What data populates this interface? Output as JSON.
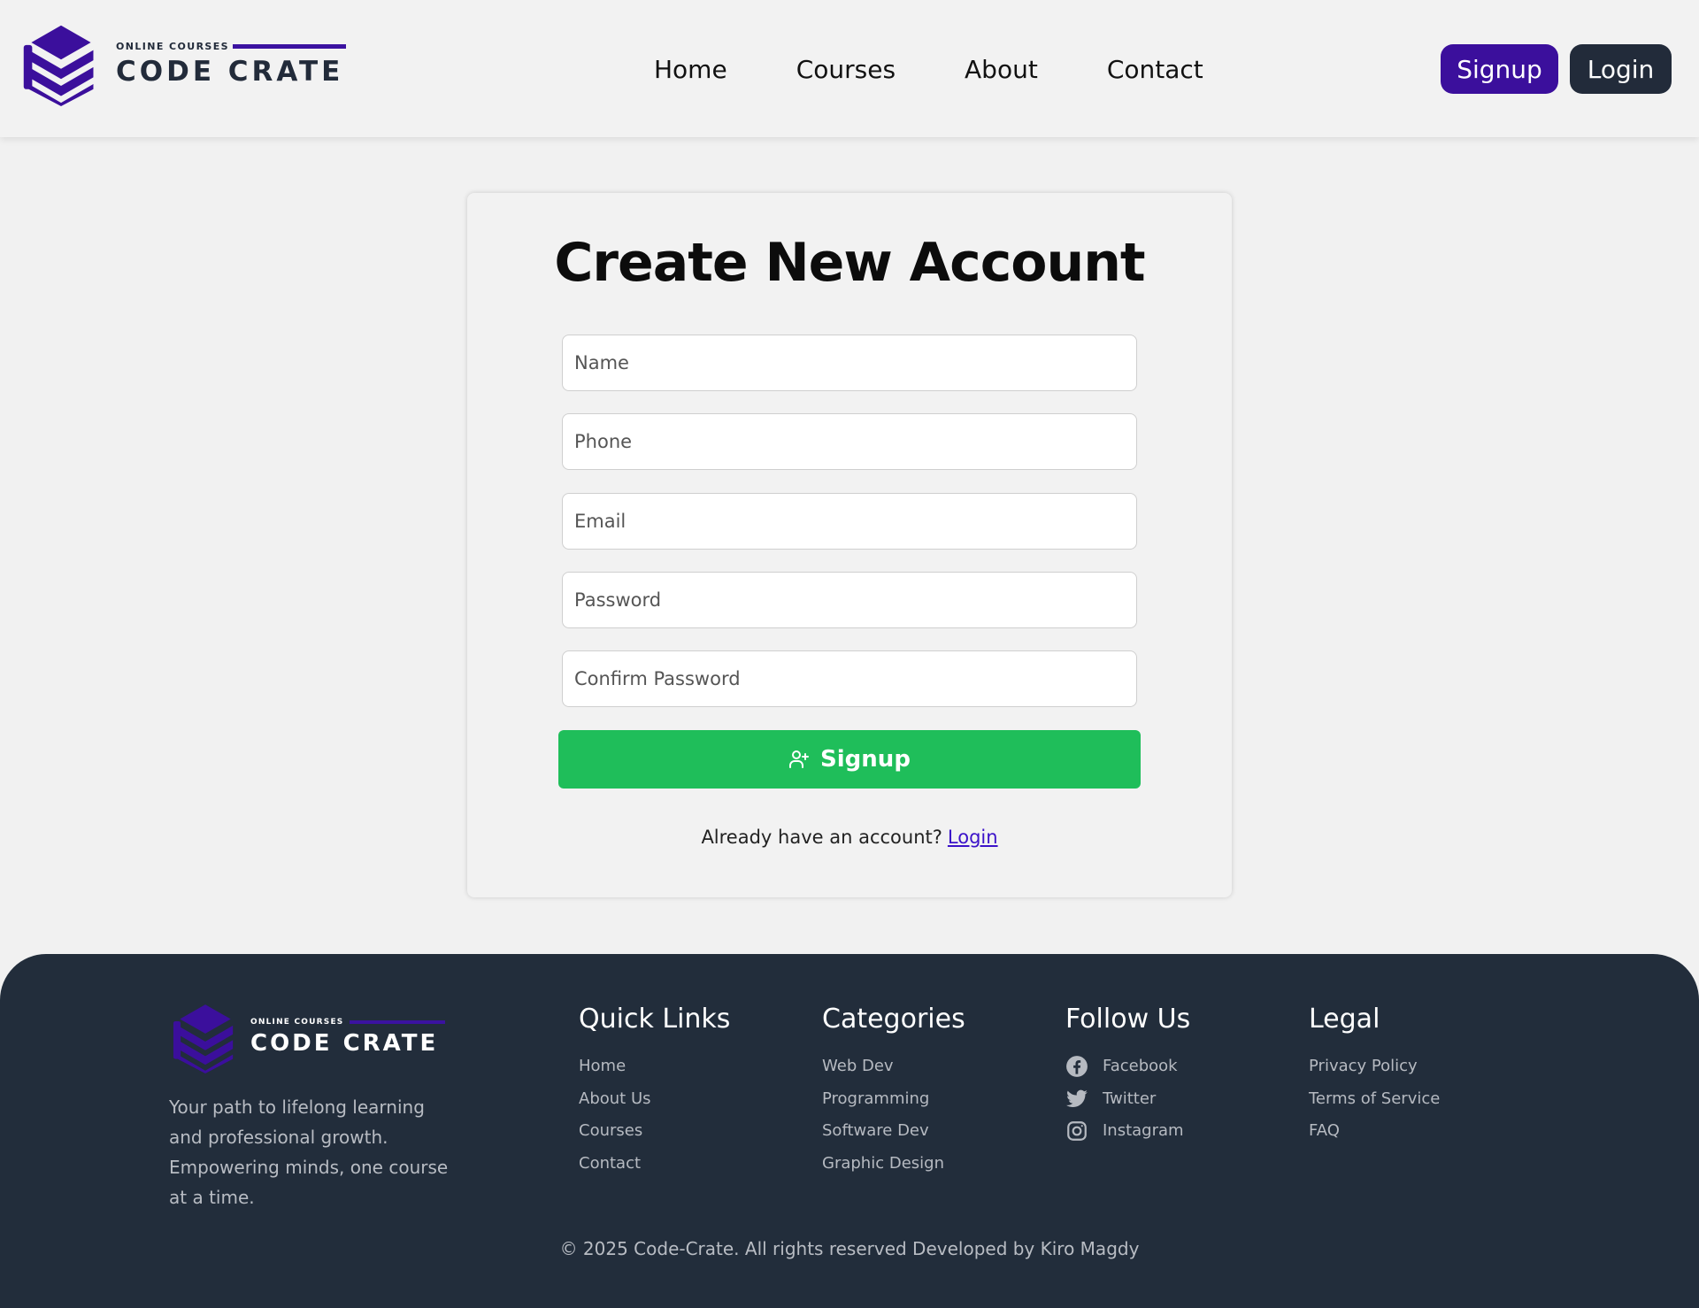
{
  "header": {
    "logo": {
      "small": "ONLINE COURSES",
      "big": "CODE CRATE",
      "icon": "stacked-crate-logo-icon"
    },
    "nav": [
      "Home",
      "Courses",
      "About",
      "Contact"
    ],
    "signup_label": "Signup",
    "login_label": "Login"
  },
  "form": {
    "title": "Create New Account",
    "fields": {
      "name": {
        "placeholder": "Name",
        "value": ""
      },
      "phone": {
        "placeholder": "Phone",
        "value": ""
      },
      "email": {
        "placeholder": "Email",
        "value": ""
      },
      "password": {
        "placeholder": "Password",
        "value": ""
      },
      "confirm": {
        "placeholder": "Confirm Password",
        "value": ""
      }
    },
    "submit_label": "Signup",
    "submit_icon": "user-plus-icon",
    "already_text": "Already have an account?",
    "login_link": "Login"
  },
  "footer": {
    "logo": {
      "small": "ONLINE COURSES",
      "big": "CODE CRATE"
    },
    "tagline": "Your path to lifelong learning and professional growth. Empowering minds, one course at a time.",
    "quick_links": {
      "title": "Quick Links",
      "items": [
        "Home",
        "About Us",
        "Courses",
        "Contact"
      ]
    },
    "categories": {
      "title": "Categories",
      "items": [
        "Web Dev",
        "Programming",
        "Software Dev",
        "Graphic Design"
      ]
    },
    "follow": {
      "title": "Follow Us",
      "items": [
        {
          "label": "Facebook",
          "icon": "facebook-icon"
        },
        {
          "label": "Twitter",
          "icon": "twitter-icon"
        },
        {
          "label": "Instagram",
          "icon": "instagram-icon"
        }
      ]
    },
    "legal": {
      "title": "Legal",
      "items": [
        "Privacy Policy",
        "Terms of Service",
        "FAQ"
      ]
    },
    "copyright": "© 2025 Code-Crate. All rights reserved Developed by Kiro Magdy"
  },
  "colors": {
    "brand_purple": "#3b0f9c",
    "dark": "#222b3a",
    "success_green": "#1fbe5a",
    "link": "#3b12c9",
    "background": "#f1f1f1"
  }
}
